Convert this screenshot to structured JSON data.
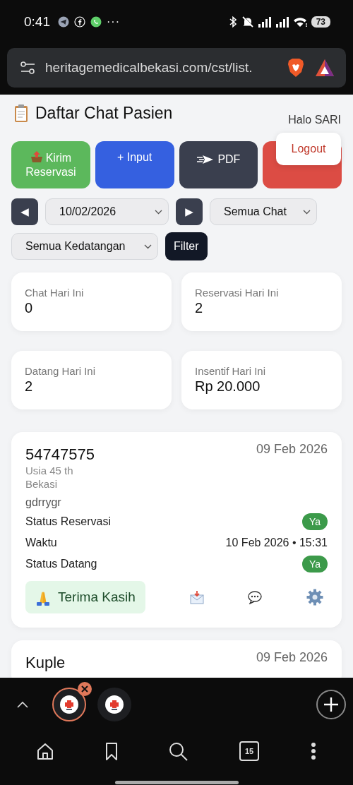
{
  "status_bar": {
    "time": "0:41",
    "more": "···",
    "battery": "73"
  },
  "browser": {
    "url": "heritagemedicalbekasi.com/cst/list.",
    "tab_count": "15",
    "tabs": [
      {
        "selected": true
      },
      {
        "selected": false
      }
    ]
  },
  "header": {
    "title": "Daftar Chat Pasien",
    "greeting": "Halo SARI"
  },
  "actions": [
    {
      "kind": "send",
      "label": "Kirim Reservasi",
      "color": "#5cb85c"
    },
    {
      "kind": "plain",
      "label": "+ Input",
      "color": "#3560e0"
    },
    {
      "kind": "pdf",
      "label": "PDF",
      "color": "#3a3f4e"
    },
    {
      "kind": "plain",
      "color": "#dc4c44"
    }
  ],
  "logout_popup": {
    "label": "Logout"
  },
  "filters": {
    "prev": "◀",
    "date": "10/02/2026",
    "next": "▶",
    "chat": "Semua Chat",
    "arrival": "Semua Kedatangan",
    "submit": "Filter"
  },
  "stats": [
    {
      "label": "Chat Hari Ini",
      "value": "0"
    },
    {
      "label": "Reservasi Hari Ini",
      "value": "2"
    },
    {
      "label": "Datang Hari Ini",
      "value": "2"
    },
    {
      "label": "Insentif Hari Ini",
      "value": "Rp 20.000"
    }
  ],
  "patients": [
    {
      "name": "54747575",
      "date": "09 Feb 2026",
      "age": "Usia 45 th",
      "city": "Bekasi",
      "message": "gdrrygr",
      "rows": [
        {
          "label": "Status Reservasi",
          "kind": "badge",
          "value": "Ya"
        },
        {
          "label": "Waktu",
          "kind": "text",
          "value": "10 Feb 2026 • 15:31"
        },
        {
          "label": "Status Datang",
          "kind": "badge",
          "value": "Ya"
        }
      ],
      "thanks": "Terima Kasih"
    },
    {
      "name": "Kuple",
      "date": "09 Feb 2026"
    }
  ]
}
